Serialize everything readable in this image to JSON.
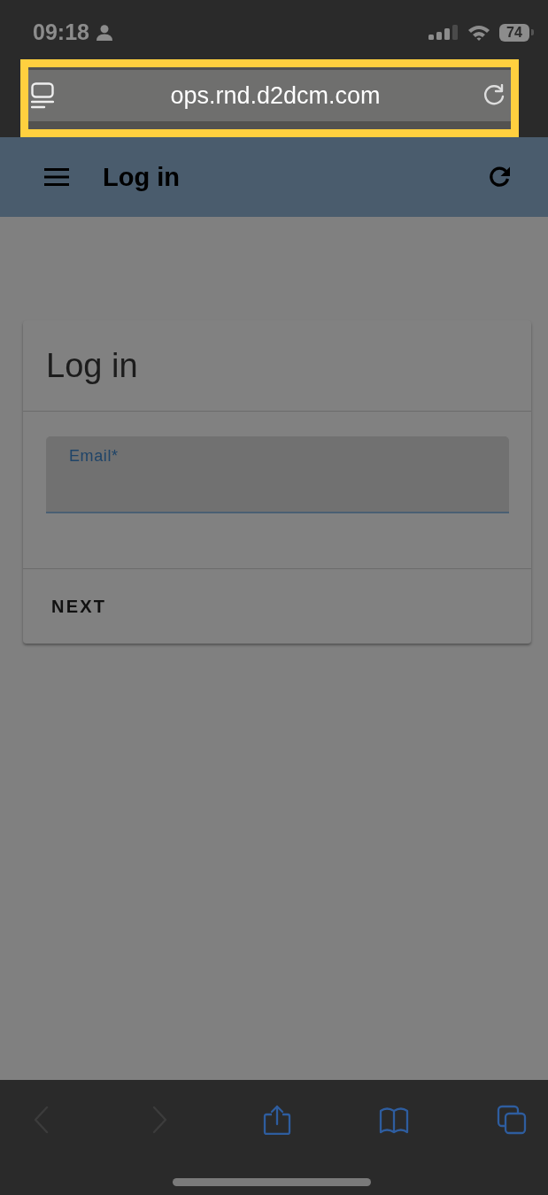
{
  "status_bar": {
    "time": "09:18",
    "battery": "74"
  },
  "address_bar": {
    "url": "ops.rnd.d2dcm.com",
    "highlighted": true
  },
  "app_bar": {
    "title": "Log in"
  },
  "login_card": {
    "title": "Log in",
    "email_field": {
      "label": "Email*"
    },
    "button": "NEXT"
  },
  "toolbar": {
    "items": [
      {
        "kind": "back",
        "disabled": true
      },
      {
        "kind": "forward",
        "disabled": true
      },
      {
        "kind": "share",
        "disabled": false
      },
      {
        "kind": "bookmarks",
        "disabled": false
      },
      {
        "kind": "tabs",
        "disabled": false
      }
    ]
  }
}
